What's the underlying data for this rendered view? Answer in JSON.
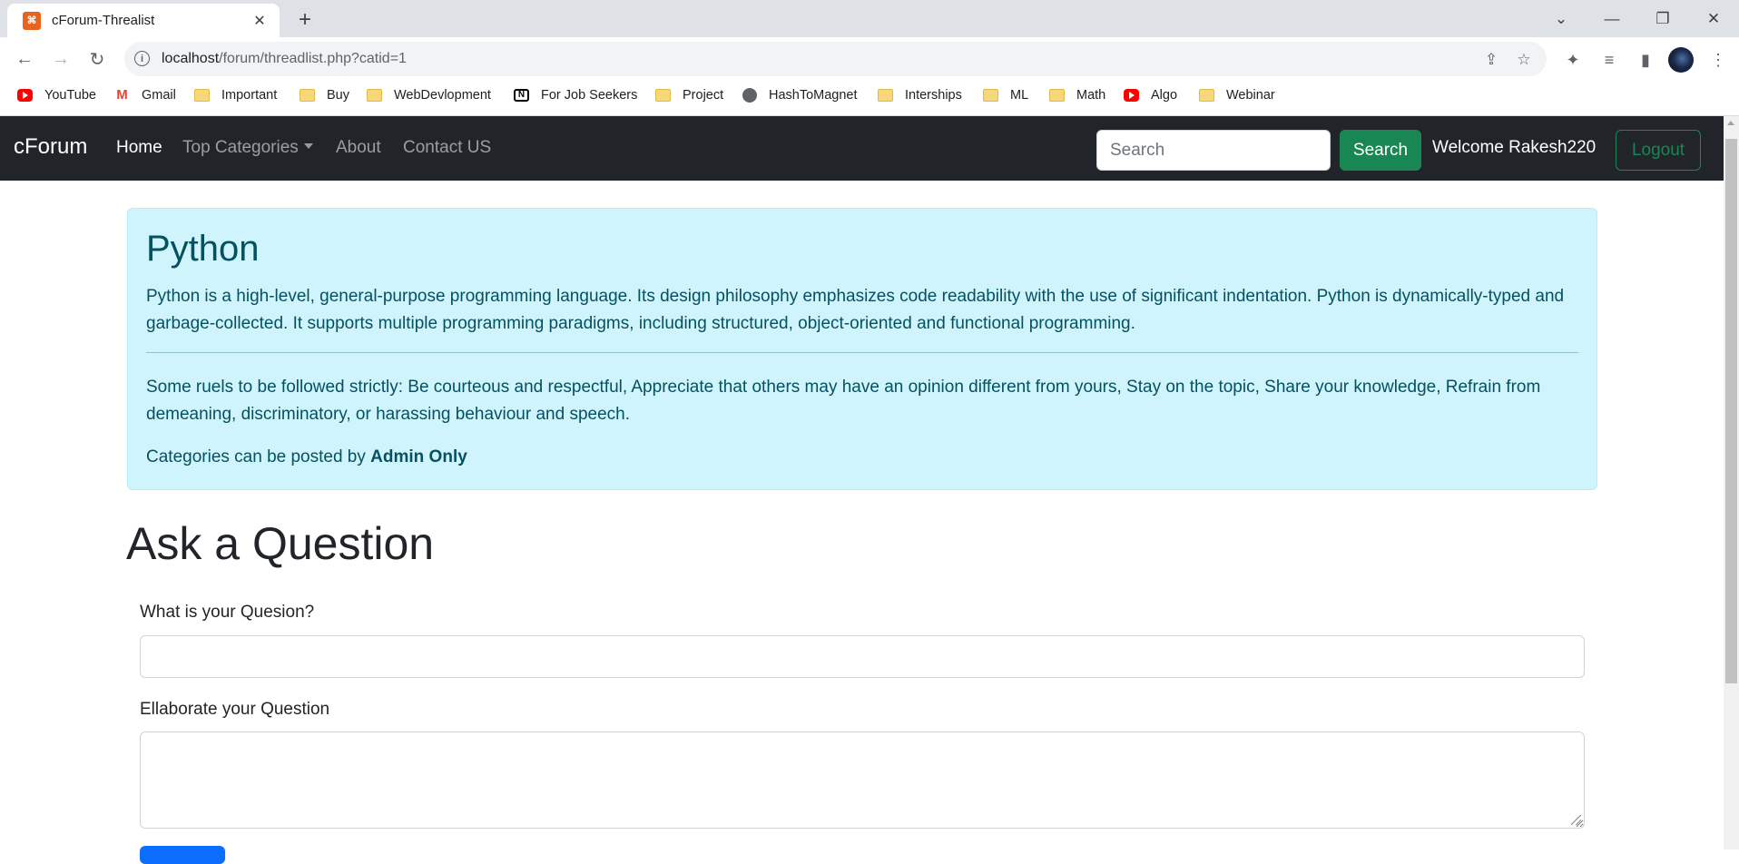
{
  "browser": {
    "tab_title": "cForum-Threalist",
    "tab_favicon_letter": "⌘",
    "url_host": "localhost",
    "url_path": "/forum/threadlist.php?catid=1",
    "bookmarks": [
      {
        "label": "YouTube",
        "icon": "youtube-icon"
      },
      {
        "label": "Gmail",
        "icon": "gmail-icon"
      },
      {
        "label": "Important",
        "icon": "folder-icon"
      },
      {
        "label": "Buy",
        "icon": "folder-icon"
      },
      {
        "label": "WebDevlopment",
        "icon": "folder-icon"
      },
      {
        "label": "For Job Seekers",
        "icon": "notion-icon"
      },
      {
        "label": "Project",
        "icon": "folder-icon"
      },
      {
        "label": "HashToMagnet",
        "icon": "globe-icon"
      },
      {
        "label": "Interships",
        "icon": "folder-icon"
      },
      {
        "label": "ML",
        "icon": "folder-icon"
      },
      {
        "label": "Math",
        "icon": "folder-icon"
      },
      {
        "label": "Algo",
        "icon": "youtube-icon"
      },
      {
        "label": "Webinar",
        "icon": "folder-icon"
      }
    ]
  },
  "navbar": {
    "brand": "cForum",
    "links": [
      "Home",
      "Top Categories",
      "About",
      "Contact US"
    ],
    "search_placeholder": "Search",
    "search_button": "Search",
    "welcome": "Welcome Rakesh220",
    "logout": "Logout"
  },
  "category": {
    "title": "Python",
    "description": "Python is a high-level, general-purpose programming language. Its design philosophy emphasizes code readability with the use of significant indentation. Python is dynamically-typed and garbage-collected. It supports multiple programming paradigms, including structured, object-oriented and functional programming.",
    "rules": "Some ruels to be followed strictly: Be courteous and respectful, Appreciate that others may have an opinion different from yours, Stay on the topic, Share your knowledge, Refrain from demeaning, discriminatory, or harassing behaviour and speech.",
    "posted_by_prefix": "Categories can be posted by ",
    "posted_by_bold": "Admin Only"
  },
  "form": {
    "heading": "Ask a Question",
    "question_label": "What is your Quesion?",
    "question_value": "",
    "elaborate_label": "Ellaborate your Question",
    "elaborate_value": ""
  },
  "colors": {
    "navbar_bg": "#212529",
    "success": "#198754",
    "info_bg": "#cff4fc",
    "info_text": "#055160",
    "primary": "#0d6efd"
  }
}
